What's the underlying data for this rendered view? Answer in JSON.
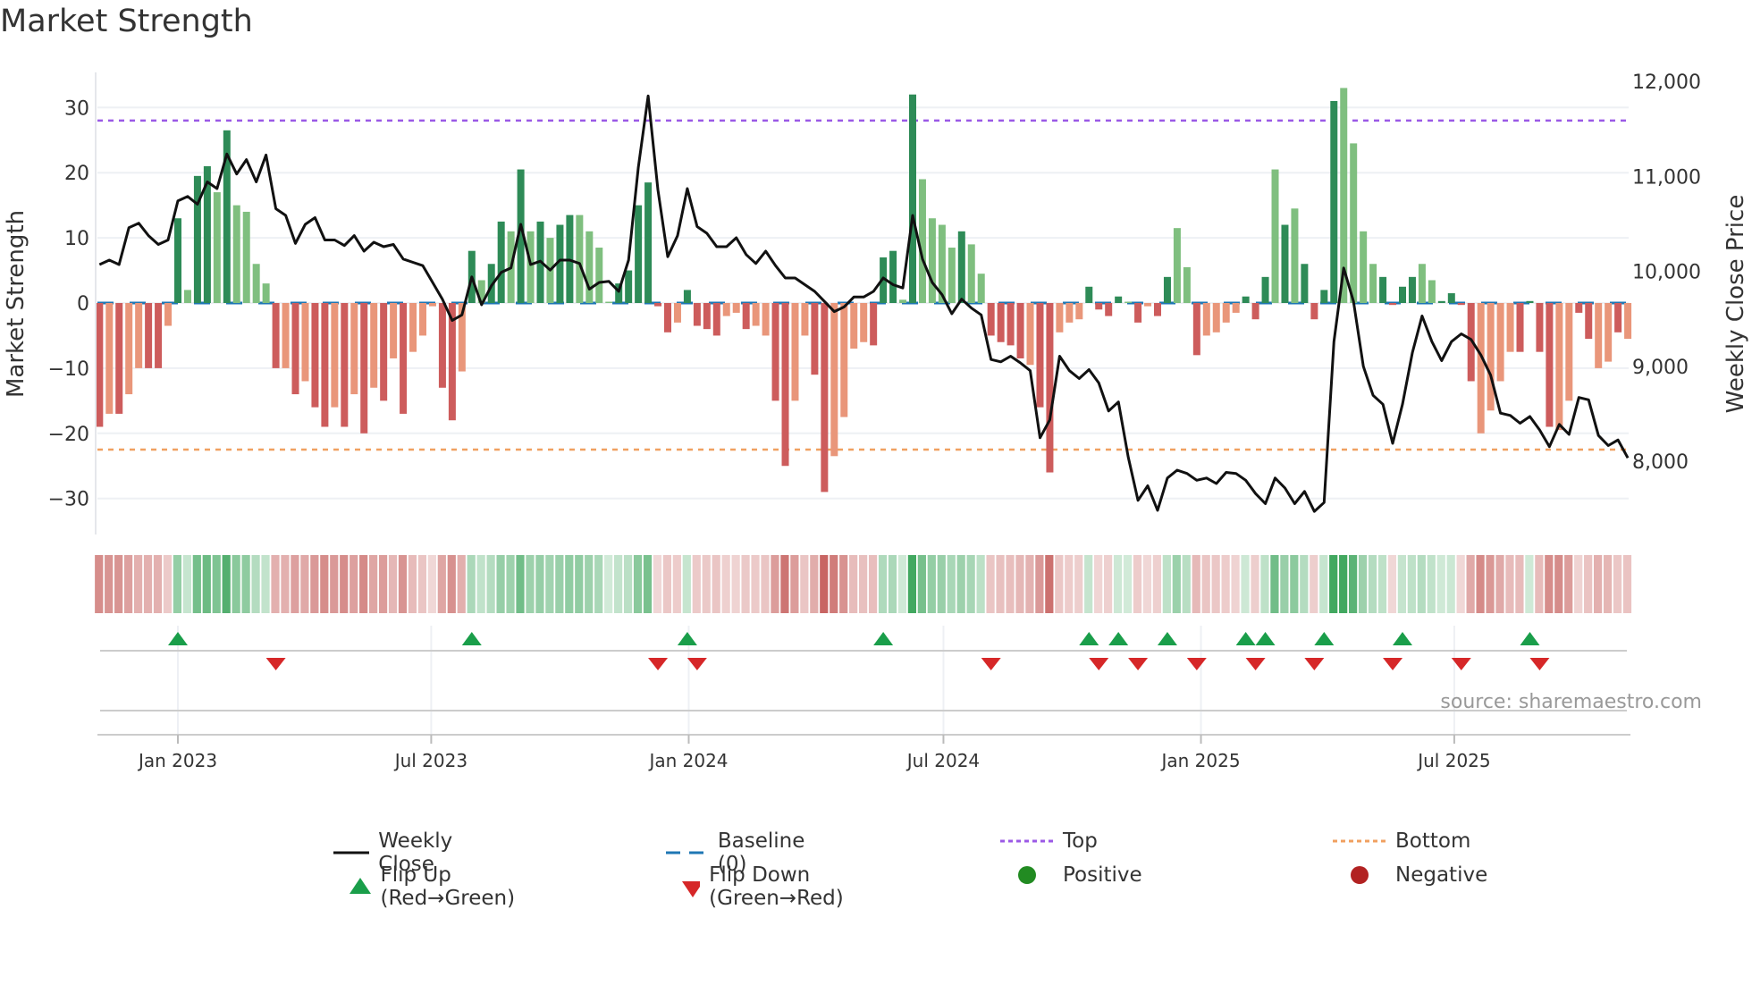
{
  "chart_data": {
    "type": "bar",
    "title": "Market Strength",
    "ylabel": "Market Strength",
    "y2label": "Weekly Close Price",
    "source": "source: sharemaestro.com",
    "frequency": "weekly",
    "start_date": "2022-11-06",
    "ylim": [
      -36,
      36
    ],
    "y2lim": [
      7300,
      12200
    ],
    "yticks": [
      30,
      20,
      10,
      0,
      -10,
      -20,
      -30
    ],
    "ytick_labels": [
      "30",
      "20",
      "10",
      "0",
      "−10",
      "−20",
      "−30"
    ],
    "y2ticks": [
      12000,
      11000,
      10000,
      9000,
      8000
    ],
    "y2tick_labels": [
      "12,000",
      "11,000",
      "10,000",
      "9,000",
      "8,000"
    ],
    "xticks": [
      {
        "date": "2023-01-01",
        "label": "Jan 2023"
      },
      {
        "date": "2023-07-01",
        "label": "Jul 2023"
      },
      {
        "date": "2024-01-01",
        "label": "Jan 2024"
      },
      {
        "date": "2024-07-01",
        "label": "Jul 2024"
      },
      {
        "date": "2025-01-01",
        "label": "Jan 2025"
      },
      {
        "date": "2025-07-01",
        "label": "Jul 2025"
      }
    ],
    "top_level": 28,
    "bottom_level": -22.5,
    "baseline": 0,
    "strength": [
      -19,
      -17,
      -17,
      -14,
      -10,
      -10,
      -10,
      -3.5,
      13,
      2,
      19.5,
      21,
      17,
      26.5,
      15,
      14,
      6,
      3,
      -10,
      -10,
      -14,
      -12,
      -16,
      -19,
      -16,
      -19,
      -14,
      -20,
      -13,
      -15,
      -8.5,
      -17,
      -7.5,
      -5,
      -0.5,
      -13,
      -18,
      -10.5,
      8,
      3.5,
      6,
      12.5,
      11,
      20.5,
      11,
      12.5,
      10,
      12,
      13.5,
      13.5,
      11,
      8.5,
      0.2,
      3,
      5,
      15,
      18.5,
      -0.5,
      -4.5,
      -3,
      2,
      -3.5,
      -4,
      -5,
      -2,
      -1.5,
      -4,
      -3.5,
      -5,
      -15,
      -25,
      -15,
      -5,
      -11,
      -29,
      -23.5,
      -17.5,
      -7,
      -6,
      -6.5,
      7,
      8,
      0.5,
      32,
      19,
      13,
      12,
      8.5,
      11,
      9,
      4.5,
      -5,
      -6,
      -6.5,
      -8.5,
      -9.5,
      -16,
      -26,
      -4.5,
      -3,
      -2.5,
      2.5,
      -1,
      -2,
      1,
      0.2,
      -3,
      -0.5,
      -2,
      4,
      11.5,
      5.5,
      -8,
      -5,
      -4.5,
      -3,
      -1.5,
      1,
      -2.5,
      4,
      20.5,
      12,
      14.5,
      6,
      -2.5,
      2,
      31,
      33,
      24.5,
      11,
      6,
      4,
      -0.3,
      2.5,
      4,
      6,
      3.5,
      0.3,
      1.5,
      -0.3,
      -12,
      -20,
      -16.5,
      -12,
      -7.5,
      -7.5,
      0.3,
      -7.5,
      -19,
      -19.5,
      -15,
      -1.5,
      -5.5,
      -10,
      -9,
      -4.5,
      -5.5
    ],
    "shade": "DLDLLDDLDLDDLDLLLLDLDLDDLDLDLDLDLLLDDLDLDDLDLDLDDLLLLDDDDDDLDDDDLLDLLDDLLDDLLLLDDDLDLLLLDLLDDDDLDDLLLDDDDLDLDDLLDLLLLDDDLDLDDDDLLLLDDDDLLDDDDLLLLDDDDLLDDLLD",
    "weekly_close": [
      10071,
      10118,
      10071,
      10459,
      10506,
      10376,
      10282,
      10329,
      10741,
      10788,
      10706,
      10941,
      10871,
      11235,
      11024,
      11176,
      10941,
      11224,
      10659,
      10588,
      10294,
      10494,
      10565,
      10329,
      10329,
      10271,
      10376,
      10212,
      10306,
      10259,
      10282,
      10129,
      10094,
      10059,
      9882,
      9706,
      9482,
      9541,
      9941,
      9647,
      9847,
      9988,
      10035,
      10494,
      10071,
      10106,
      10012,
      10118,
      10118,
      10082,
      9812,
      9882,
      9894,
      9788,
      10118,
      11094,
      11847,
      10859,
      10153,
      10376,
      10871,
      10471,
      10400,
      10259,
      10259,
      10353,
      10176,
      10082,
      10212,
      10059,
      9929,
      9929,
      9859,
      9788,
      9682,
      9576,
      9624,
      9729,
      9729,
      9788,
      9929,
      9859,
      9824,
      10588,
      10129,
      9882,
      9753,
      9553,
      9706,
      9612,
      9541,
      9071,
      9047,
      9106,
      9035,
      8953,
      8247,
      8435,
      9106,
      8953,
      8871,
      8965,
      8824,
      8529,
      8624,
      8047,
      7588,
      7741,
      7482,
      7823,
      7906,
      7871,
      7800,
      7823,
      7765,
      7882,
      7871,
      7800,
      7659,
      7553,
      7823,
      7718,
      7553,
      7682,
      7471,
      7565,
      9259,
      10035,
      9682,
      9000,
      8694,
      8600,
      8188,
      8600,
      9141,
      9529,
      9259,
      9059,
      9259,
      9341,
      9282,
      9118,
      8906,
      8506,
      8482,
      8400,
      8471,
      8329,
      8153,
      8388,
      8282,
      8671,
      8647,
      8271,
      8165,
      8224,
      8035
    ],
    "flip_up_weeks": [
      8,
      38,
      60,
      80,
      101,
      104,
      109,
      117,
      119,
      125,
      133,
      146
    ],
    "flip_down_weeks": [
      18,
      57,
      61,
      91,
      102,
      106,
      112,
      118,
      124,
      132,
      139,
      147
    ],
    "legend_position": "bottom",
    "legend": [
      {
        "key": "weekly_close",
        "label": "Weekly Close"
      },
      {
        "key": "baseline",
        "label": "Baseline (0)"
      },
      {
        "key": "top",
        "label": "Top"
      },
      {
        "key": "bottom",
        "label": "Bottom"
      },
      {
        "key": "flip_up",
        "label": "Flip Up (Red→Green)"
      },
      {
        "key": "flip_down",
        "label": "Flip Down (Green→Red)"
      },
      {
        "key": "positive",
        "label": "Positive"
      },
      {
        "key": "negative",
        "label": "Negative"
      }
    ],
    "colors": {
      "pos_dark": "#2e8b57",
      "pos_light": "#7fbf7f",
      "neg_dark": "#cd5c5c",
      "neg_light": "#e9967a",
      "line": "#111111",
      "baseline": "#1f77b4",
      "top": "#9b59e6",
      "bottom": "#f0a060",
      "flip_up": "#1a9e4a",
      "flip_down": "#d62728",
      "positive": "#228b22",
      "negative": "#b22222"
    }
  }
}
